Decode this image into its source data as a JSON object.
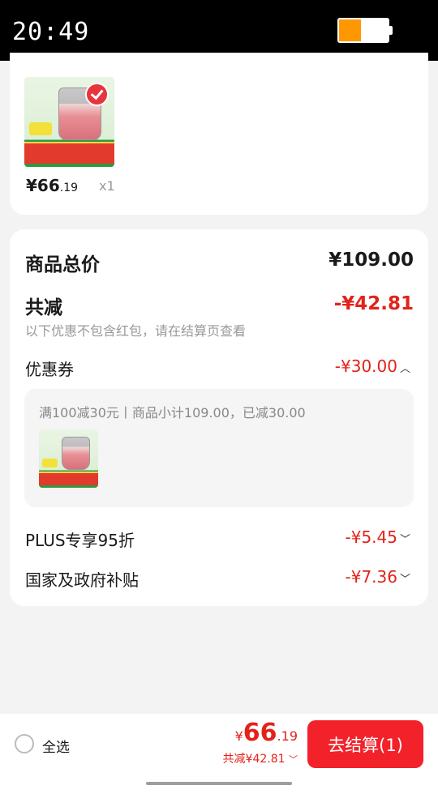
{
  "status_bar": {
    "time": "20:49",
    "battery_level": 0.45,
    "battery_color": "#ff9800"
  },
  "product": {
    "price_symbol": "¥",
    "price_int": "66",
    "price_dec": ".19",
    "quantity": "x1"
  },
  "summary": {
    "total_label": "商品总价",
    "total_value": "¥109.00",
    "discount_label": "共减",
    "discount_value": "-¥42.81",
    "discount_note": "以下优惠不包含红包，请在结算页查看",
    "coupon_label": "优惠券",
    "coupon_value": "-¥30.00",
    "coupon_detail": "满100减30元丨商品小计109.00，已减30.00",
    "plus_label": "PLUS专享95折",
    "plus_value": "-¥5.45",
    "subsidy_label": "国家及政府补贴",
    "subsidy_value": "-¥7.36"
  },
  "bottom_bar": {
    "select_all_label": "全选",
    "total_symbol": "¥",
    "total_int": "66",
    "total_dec": ".19",
    "total_discount": "共减¥42.81",
    "checkout_label": "去结算(1)"
  },
  "colors": {
    "accent_red": "#e2231a",
    "checkout_button": "#f2212a"
  }
}
